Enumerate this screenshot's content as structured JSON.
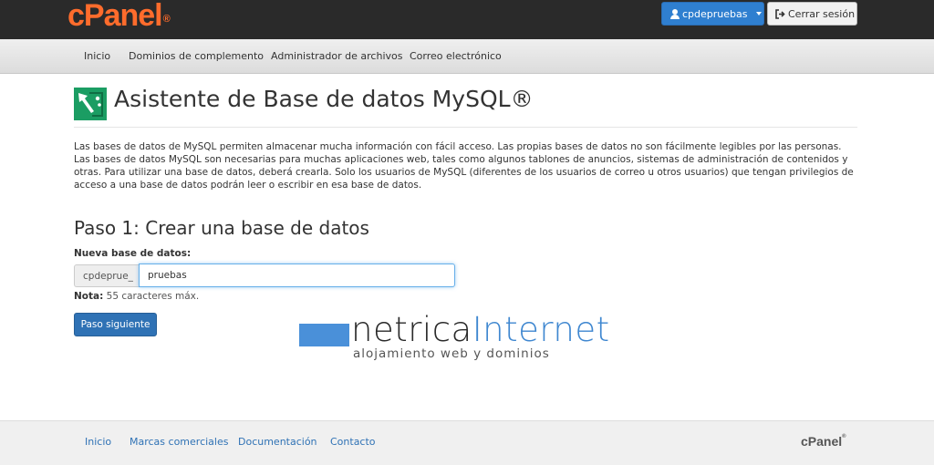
{
  "header": {
    "logo_text": "cPanel",
    "logo_mark": "®",
    "user_button": "cpdepruebas",
    "logout_button": "Cerrar sesión",
    "user_icon": "user-icon",
    "logout_icon": "sign-out-icon"
  },
  "nav": {
    "items": [
      {
        "label": "Inicio"
      },
      {
        "label": "Dominios de complemento"
      },
      {
        "label": "Administrador de archivos"
      },
      {
        "label": "Correo electrónico"
      }
    ]
  },
  "page": {
    "title": "Asistente de Base de datos MySQL®",
    "title_icon": "mysql-wizard-icon",
    "description": "Las bases de datos de MySQL permiten almacenar mucha información con fácil acceso. Las propias bases de datos no son fácilmente legibles por las personas. Las bases de datos MySQL son necesarias para muchas aplicaciones web, tales como algunos tablones de anuncios, sistemas de administración de contenidos y otras. Para utilizar una base de datos, deberá crearla. Solo los usuarios de MySQL (diferentes de los usuarios de correo u otros usuarios) que tengan privilegios de acceso a una base de datos podrán leer o escribir en esa base de datos."
  },
  "step": {
    "title": "Paso 1: Crear una base de datos",
    "field_label": "Nueva base de datos:",
    "prefix": "cpdeprue_",
    "input_value": "pruebas",
    "note_label": "Nota:",
    "note_text": " 55 caracteres máx.",
    "next_button": "Paso siguiente"
  },
  "watermark": {
    "brand_part1": "netrica",
    "brand_part2": "Internet",
    "tagline": "alojamiento web y dominios"
  },
  "footer": {
    "links": [
      {
        "label": "Inicio"
      },
      {
        "label": "Marcas comerciales"
      },
      {
        "label": "Documentación"
      },
      {
        "label": "Contacto"
      }
    ],
    "logo_text": "cPanel",
    "logo_mark": "®"
  },
  "colors": {
    "topbar": "#2a2a2a",
    "logo": "#ff6c2c",
    "primary": "#2f72b5",
    "title_icon": "#1b9d63"
  }
}
